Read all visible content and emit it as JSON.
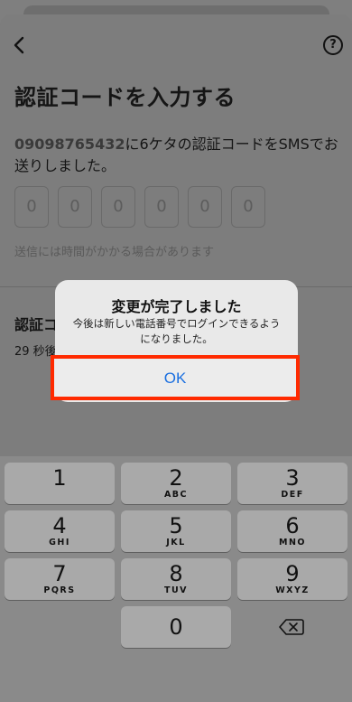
{
  "header": {
    "title": "認証コードを入力する"
  },
  "description": {
    "phone": "09098765432",
    "text": "に6ケタの認証コードをSMSでお送りしました。"
  },
  "code_boxes": [
    "0",
    "0",
    "0",
    "0",
    "0",
    "0"
  ],
  "hint": "送信には時間がかかる場合があります",
  "resend": {
    "title": "認証コ",
    "countdown": "29 秒後"
  },
  "alert": {
    "title": "変更が完了しました",
    "message": "今後は新しい電話番号でログインできるようになりました。",
    "ok_label": "OK"
  },
  "keypad": {
    "keys": [
      {
        "num": "1",
        "letters": ""
      },
      {
        "num": "2",
        "letters": "ABC"
      },
      {
        "num": "3",
        "letters": "DEF"
      },
      {
        "num": "4",
        "letters": "GHI"
      },
      {
        "num": "5",
        "letters": "JKL"
      },
      {
        "num": "6",
        "letters": "MNO"
      },
      {
        "num": "7",
        "letters": "PQRS"
      },
      {
        "num": "8",
        "letters": "TUV"
      },
      {
        "num": "9",
        "letters": "WXYZ"
      },
      {
        "num": "0",
        "letters": ""
      }
    ]
  },
  "icons": {
    "back": "chevron-left-icon",
    "help": "question-circle-icon",
    "delete": "backspace-icon"
  },
  "colors": {
    "ok_text": "#1a6fe0",
    "highlight": "#ff2a00"
  }
}
